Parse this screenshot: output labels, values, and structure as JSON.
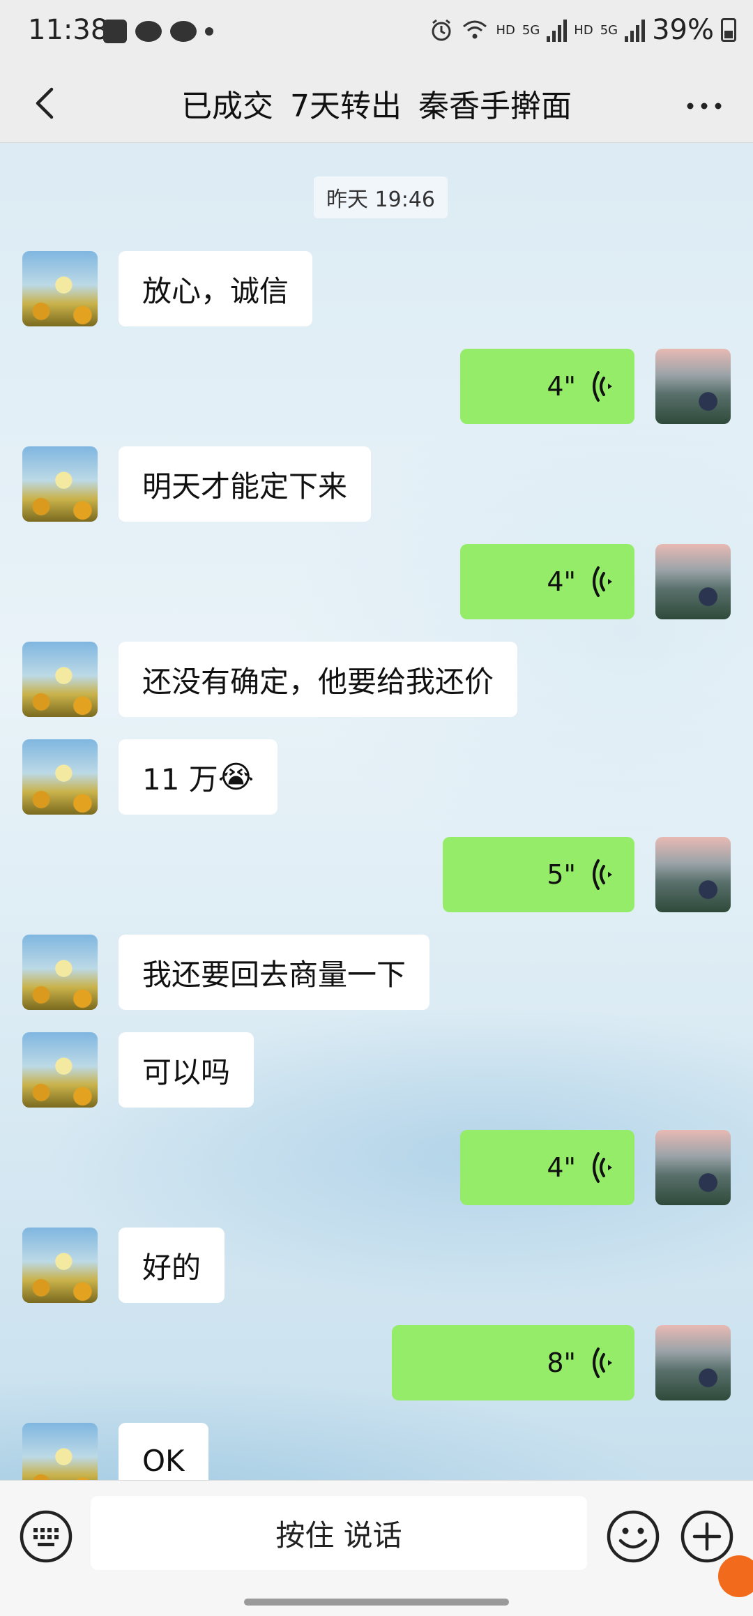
{
  "status_bar": {
    "time": "11:38",
    "hd1": "HD",
    "net1": "5G",
    "hd2": "HD",
    "net2": "5G",
    "battery": "39%"
  },
  "nav": {
    "title": "已成交  7天转出  秦香手擀面"
  },
  "chat": {
    "timestamp": "昨天 19:46",
    "messages": [
      {
        "from": "them",
        "type": "text",
        "text": "放心，诚信"
      },
      {
        "from": "me",
        "type": "voice",
        "duration": "4\""
      },
      {
        "from": "them",
        "type": "text",
        "text": "明天才能定下来"
      },
      {
        "from": "me",
        "type": "voice",
        "duration": "4\""
      },
      {
        "from": "them",
        "type": "text",
        "text": "还没有确定，他要给我还价"
      },
      {
        "from": "them",
        "type": "text",
        "text": "11 万",
        "emoji": "😭"
      },
      {
        "from": "me",
        "type": "voice",
        "duration": "5\""
      },
      {
        "from": "them",
        "type": "text",
        "text": "我还要回去商量一下"
      },
      {
        "from": "them",
        "type": "text",
        "text": "可以吗"
      },
      {
        "from": "me",
        "type": "voice",
        "duration": "4\""
      },
      {
        "from": "them",
        "type": "text",
        "text": "好的"
      },
      {
        "from": "me",
        "type": "voice",
        "duration": "8\""
      },
      {
        "from": "them",
        "type": "text",
        "text": "OK"
      }
    ]
  },
  "input_bar": {
    "hold_to_talk": "按住 说话"
  },
  "colors": {
    "my_bubble": "#95ec69",
    "their_bubble": "#ffffff",
    "badge": "#f26a1b"
  },
  "icons": {
    "back": "chevron-left-icon",
    "more": "more-dots-icon",
    "voice": "voice-wave-icon",
    "keyboard": "keyboard-icon",
    "emoji": "emoji-icon",
    "plus": "plus-icon"
  }
}
